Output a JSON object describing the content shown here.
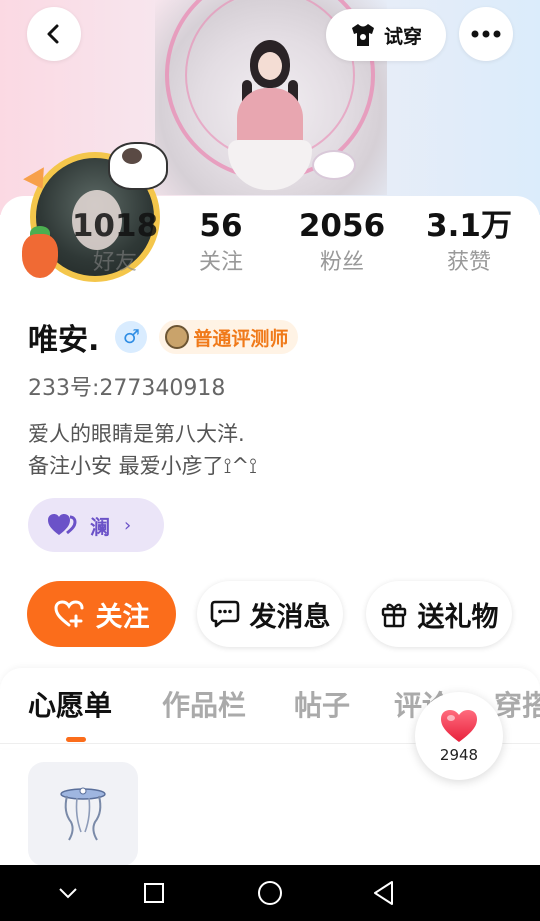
{
  "header": {
    "back_icon": "chevron-left-icon",
    "tryon_label": "试穿",
    "tryon_icon": "tshirt-icon",
    "more_icon": "more-dots-icon"
  },
  "stats": [
    {
      "value": "1018",
      "label": "好友"
    },
    {
      "value": "56",
      "label": "关注"
    },
    {
      "value": "2056",
      "label": "粉丝"
    },
    {
      "value": "3.1万",
      "label": "获赞"
    }
  ],
  "profile": {
    "name": "唯安.",
    "gender_symbol": "♂",
    "badge_label": "普通评测师",
    "uid": "233号:277340918",
    "bio_line1": "爱人的眼睛是第八大洋.",
    "bio_line2": "备注小安 最爱小彦了⟟^⟟",
    "lan_label": "澜",
    "lan_chevron": "›"
  },
  "actions": {
    "follow_label": "关注",
    "message_label": "发消息",
    "gift_label": "送礼物"
  },
  "tabs": [
    {
      "label": "心愿单",
      "active": true
    },
    {
      "label": "作品栏",
      "active": false
    },
    {
      "label": "帖子",
      "active": false
    },
    {
      "label": "评论",
      "active": false
    },
    {
      "label": "穿搭",
      "active": false
    }
  ],
  "like_float": {
    "count": "2948"
  },
  "colors": {
    "accent_orange": "#fb6d1b",
    "badge_orange": "#f07a1a",
    "lan_purple": "#6b52c8",
    "like_red": "#f0324a"
  },
  "system_nav": [
    "chevron-down-icon",
    "square-icon",
    "circle-icon",
    "triangle-back-icon"
  ]
}
